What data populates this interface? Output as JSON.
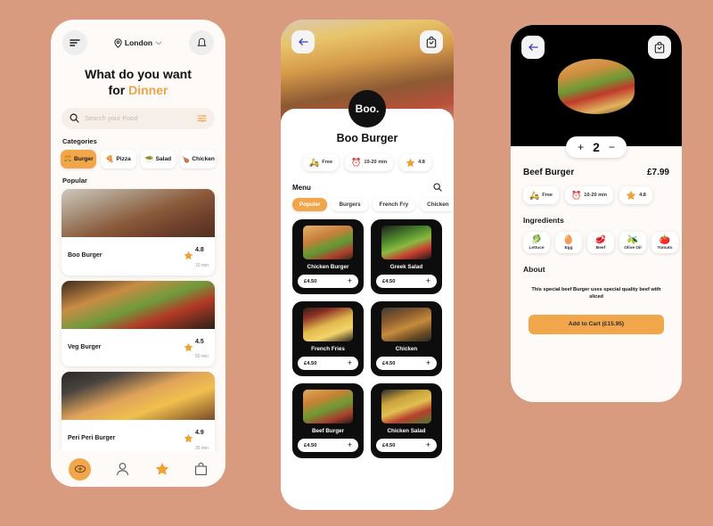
{
  "theme": {
    "background": "#d89b7f",
    "accent": "#f2a64c",
    "card_dark": "#0d0d0d"
  },
  "home": {
    "location": "London",
    "menu_icon": "hamburger-menu-icon",
    "bell_icon": "notification-bell-icon",
    "headline_line1": "What do you want",
    "headline_line2_prefix": "for ",
    "headline_accent": "Dinner",
    "search": {
      "placeholder": "Search your Food",
      "icon": "search-icon",
      "filter_icon": "filter-icon"
    },
    "categories_label": "Categories",
    "categories": [
      {
        "label": "Burger",
        "emoji": "🍔",
        "active": true
      },
      {
        "label": "Pizza",
        "emoji": "🍕",
        "active": false
      },
      {
        "label": "Salad",
        "emoji": "🥗",
        "active": false
      },
      {
        "label": "Chicken",
        "emoji": "🍗",
        "active": false
      }
    ],
    "popular_label": "Popular",
    "popular": [
      {
        "name": "Boo Burger",
        "rating": "4.8",
        "time": "10 min"
      },
      {
        "name": "Veg Burger",
        "rating": "4.5",
        "time": "50 min"
      },
      {
        "name": "Peri Peri Burger",
        "rating": "4.9",
        "time": "35 min"
      }
    ],
    "tabbar": [
      {
        "name": "home",
        "icon": "home-icon",
        "active": true
      },
      {
        "name": "profile",
        "icon": "person-icon",
        "active": false
      },
      {
        "name": "favorites",
        "icon": "star-icon",
        "active": false
      },
      {
        "name": "cart",
        "icon": "shopping-bag-icon",
        "active": false
      }
    ]
  },
  "store": {
    "back_icon": "back-arrow-icon",
    "cart_icon": "shopping-bag-icon",
    "logo": "Boo.",
    "title": "Boo Burger",
    "chips": [
      {
        "emoji": "🛵",
        "label": "Free"
      },
      {
        "emoji": "⏰",
        "label": "10-20 min"
      },
      {
        "emoji": "⭐",
        "label": "4.8"
      }
    ],
    "menu_label": "Menu",
    "search_icon": "search-icon",
    "tabs": [
      {
        "label": "Populer",
        "active": true
      },
      {
        "label": "Burgers",
        "active": false
      },
      {
        "label": "French Fry",
        "active": false
      },
      {
        "label": "Chicken",
        "active": false
      }
    ],
    "items": [
      {
        "name": "Chicken  Burger",
        "price": "£4.50"
      },
      {
        "name": "Greek Salad",
        "price": "£4.50"
      },
      {
        "name": "French Fries",
        "price": "£4.50"
      },
      {
        "name": "Chicken",
        "price": "£4.50"
      },
      {
        "name": "Beef Burger",
        "price": "£4.50"
      },
      {
        "name": "Chicken Salad",
        "price": "£4.50"
      }
    ],
    "add_label": "+"
  },
  "detail": {
    "back_icon": "back-arrow-icon",
    "cart_icon": "shopping-bag-icon",
    "stepper": {
      "increase": "+",
      "quantity": "2",
      "decrease": "−"
    },
    "name": "Beef Burger",
    "price": "£7.99",
    "chips": [
      {
        "emoji": "🛵",
        "label": "Free"
      },
      {
        "emoji": "⏰",
        "label": "10-20 min"
      },
      {
        "emoji": "⭐",
        "label": "4.8"
      }
    ],
    "ingredients_label": "Ingredients",
    "ingredients": [
      {
        "emoji": "🥬",
        "label": "Lettuce"
      },
      {
        "emoji": "🥚",
        "label": "Egg"
      },
      {
        "emoji": "🥩",
        "label": "Beef"
      },
      {
        "emoji": "🫒",
        "label": "Olive Oil"
      },
      {
        "emoji": "🍅",
        "label": "Tomato"
      }
    ],
    "about_label": "About",
    "about_text": "This  special beef Burger uses special quality beef with sliced",
    "cta": "Add to Cart (£15.95)"
  }
}
